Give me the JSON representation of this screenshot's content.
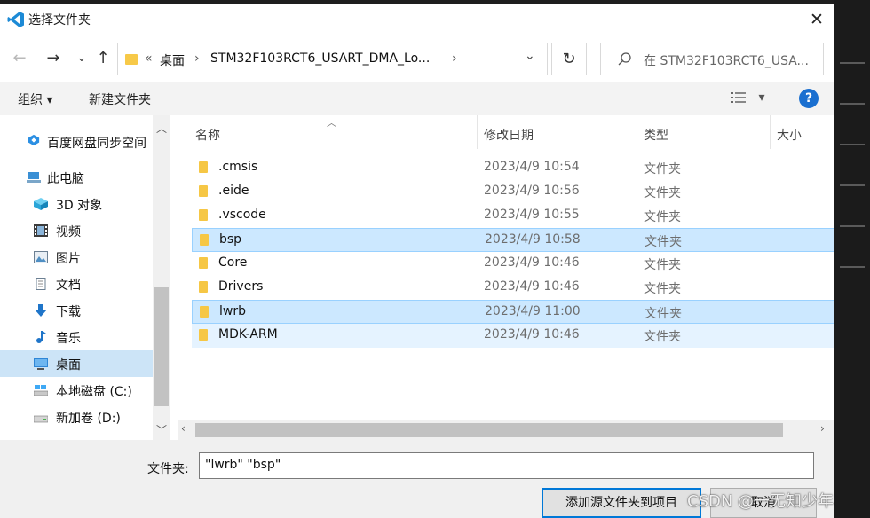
{
  "window": {
    "title": "选择文件夹",
    "close_glyph": "✕"
  },
  "nav_buttons": {
    "back": "←",
    "forward": "→",
    "recent": "⌄",
    "up": "↑"
  },
  "address": {
    "overflow": "«",
    "crumbs": [
      "桌面",
      "STM32F103RCT6_USART_DMA_Lo..."
    ],
    "separator": "›",
    "dropdown": "⌄"
  },
  "refresh_glyph": "↻",
  "search": {
    "placeholder": "在 STM32F103RCT6_USA...",
    "icon": "search-icon"
  },
  "toolbar": {
    "organize": "组织 ▾",
    "new_folder": "新建文件夹",
    "view_menu": "▾",
    "help": "?"
  },
  "sidebar": {
    "items": [
      {
        "label": "百度网盘同步空间",
        "icon": "baidu-sync-icon"
      },
      {
        "label": "此电脑",
        "icon": "computer-icon"
      },
      {
        "label": "3D 对象",
        "icon": "3d-objects-icon"
      },
      {
        "label": "视频",
        "icon": "video-icon"
      },
      {
        "label": "图片",
        "icon": "pictures-icon"
      },
      {
        "label": "文档",
        "icon": "documents-icon"
      },
      {
        "label": "下载",
        "icon": "download-icon"
      },
      {
        "label": "音乐",
        "icon": "music-icon"
      },
      {
        "label": "桌面",
        "icon": "desktop-icon",
        "selected": true
      },
      {
        "label": "本地磁盘 (C:)",
        "icon": "drive-c-icon"
      },
      {
        "label": "新加卷 (D:)",
        "icon": "drive-d-icon"
      }
    ]
  },
  "columns": {
    "name": "名称",
    "modified": "修改日期",
    "type": "类型",
    "size": "大小"
  },
  "files": [
    {
      "name": ".cmsis",
      "modified": "2023/4/9 10:54",
      "type": "文件夹"
    },
    {
      "name": ".eide",
      "modified": "2023/4/9 10:56",
      "type": "文件夹"
    },
    {
      "name": ".vscode",
      "modified": "2023/4/9 10:55",
      "type": "文件夹"
    },
    {
      "name": "bsp",
      "modified": "2023/4/9 10:58",
      "type": "文件夹",
      "state": "hover"
    },
    {
      "name": "Core",
      "modified": "2023/4/9 10:46",
      "type": "文件夹"
    },
    {
      "name": "Drivers",
      "modified": "2023/4/9 10:46",
      "type": "文件夹"
    },
    {
      "name": "lwrb",
      "modified": "2023/4/9 11:00",
      "type": "文件夹",
      "state": "selected"
    },
    {
      "name": "MDK-ARM",
      "modified": "2023/4/9 10:46",
      "type": "文件夹",
      "state": "hover"
    }
  ],
  "footer": {
    "folder_label": "文件夹:",
    "folder_value": "\"lwrb\" \"bsp\"",
    "confirm": "添加源文件夹到项目",
    "cancel": "取消"
  },
  "watermark": "CSDN @一无知少年",
  "colors": {
    "accent": "#0078d7",
    "selection": "#cce8ff",
    "hover": "#e5f3ff",
    "folder": "#f6c745",
    "sidebar_selected": "#cce4f7"
  }
}
